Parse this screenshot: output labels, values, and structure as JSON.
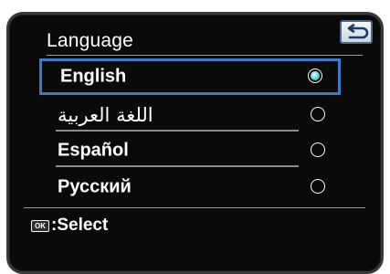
{
  "menu": {
    "title": "Language",
    "back_icon": "return-arrow-icon",
    "options": [
      {
        "label": "English",
        "selected": true
      },
      {
        "label": "اللغة العربية",
        "selected": false
      },
      {
        "label": "Español",
        "selected": false
      },
      {
        "label": "Русский",
        "selected": false
      }
    ]
  },
  "footer": {
    "ok_badge": "OK",
    "hint": ":Select"
  },
  "colors": {
    "background": "#0a0a0a",
    "highlight_border": "#3f79c4",
    "radio_fill": "#5ed3d8",
    "text": "#ffffff"
  }
}
